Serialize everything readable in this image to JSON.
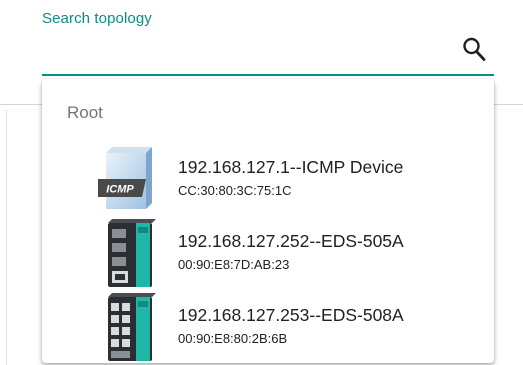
{
  "search": {
    "label": "Search topology",
    "value": "",
    "icon": "search-icon"
  },
  "dropdown": {
    "group_label": "Root",
    "options": [
      {
        "title": "192.168.127.1--ICMP Device",
        "mac": "CC:30:80:3C:75:1C",
        "icon": "icmp-device-icon",
        "badge": "ICMP"
      },
      {
        "title": "192.168.127.252--EDS-505A",
        "mac": "00:90:E8:7D:AB:23",
        "icon": "eds-505a-switch-icon"
      },
      {
        "title": "192.168.127.253--EDS-508A",
        "mac": "00:90:E8:80:2B:6B",
        "icon": "eds-508a-switch-icon"
      }
    ]
  },
  "colors": {
    "accent": "#0a8d84",
    "switch_green": "#1fb7a8",
    "switch_body": "#2b2f33"
  }
}
